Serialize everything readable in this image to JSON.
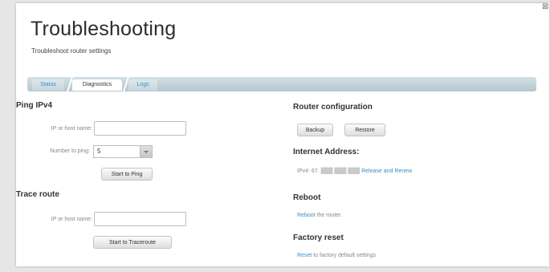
{
  "window": {
    "close_glyph": "⊠"
  },
  "header": {
    "title": "Troubleshooting",
    "subtitle": "Troubleshoot router settings"
  },
  "tabs": [
    {
      "label": "Status",
      "active": false
    },
    {
      "label": "Diagnostics",
      "active": true
    },
    {
      "label": "Logs",
      "active": false
    }
  ],
  "ping": {
    "heading": "Ping IPv4",
    "host_label": "IP or host name:",
    "host_value": "",
    "count_label": "Number to ping:",
    "count_value": "5",
    "start_label": "Start to Ping"
  },
  "trace": {
    "heading": "Trace route",
    "host_label": "IP or host name:",
    "host_value": "",
    "start_label": "Start to Traceroute"
  },
  "router_config": {
    "heading": "Router configuration",
    "backup_label": "Backup",
    "restore_label": "Restore"
  },
  "internet_address": {
    "heading": "Internet Address:",
    "prefix": "IPv4: 67.",
    "masked": "███.███.███",
    "action_label": "Release and Renew"
  },
  "reboot": {
    "heading": "Reboot",
    "link_label": "Reboot",
    "suffix": " the router."
  },
  "factory_reset": {
    "heading": "Factory reset",
    "link_label": "Reset",
    "suffix": " to factory default settings"
  },
  "colors": {
    "link": "#3a8fbf",
    "tabbar": "#c4d4db",
    "background": "#e6e6e6"
  },
  "icons": {
    "close": "close-icon",
    "dropdown": "chevron-down-icon"
  }
}
